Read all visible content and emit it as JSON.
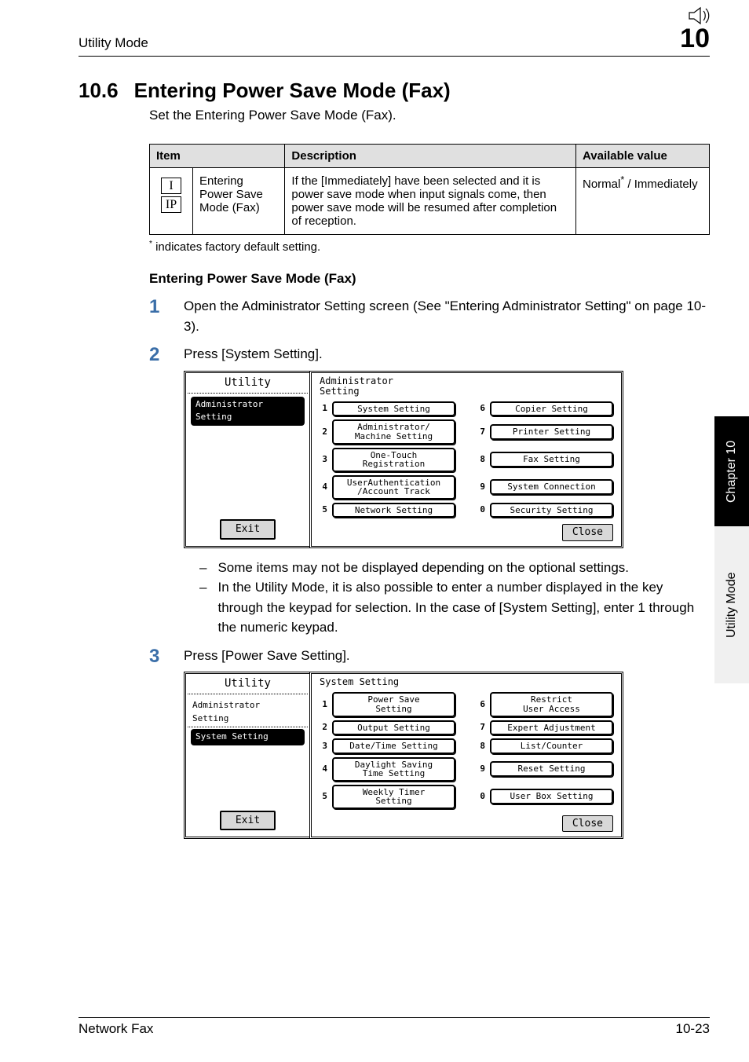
{
  "header": {
    "running_head_left": "Utility Mode",
    "running_head_right": "10"
  },
  "section": {
    "number": "10.6",
    "title": "Entering Power Save Mode (Fax)",
    "lead": "Set the Entering Power Save Mode (Fax)."
  },
  "table": {
    "headers": {
      "item": "Item",
      "description": "Description",
      "available": "Available value"
    },
    "row": {
      "iip_top": "I",
      "iip_bottom": "IP",
      "item_label": "Entering Power Save Mode (Fax)",
      "description": "If the [Immediately] have been selected and it is power save mode when input signals come, then power save mode will be resumed after completion of reception.",
      "available_pre": "Normal",
      "available_sup": "*",
      "available_post": " / Immediately"
    }
  },
  "footnote": " indicates factory default setting.",
  "footnote_star": "*",
  "subhead": "Entering Power Save Mode (Fax)",
  "steps": [
    {
      "n": "1",
      "text": "Open the Administrator Setting screen (See \"Entering Administrator Setting\" on page 10-3)."
    },
    {
      "n": "2",
      "text": "Press [System Setting]."
    },
    {
      "n": "3",
      "text": "Press [Power Save Setting]."
    }
  ],
  "notes_after_panel1": [
    "Some items may not be displayed depending on the optional settings.",
    "In the Utility Mode, it is also possible to enter a number displayed in the key through the keypad for selection. In the case of [System Setting], enter 1 through the numeric keypad."
  ],
  "panel_common": {
    "utility_label": "Utility",
    "sidebar_item": "Administrator\nSetting",
    "exit": "Exit",
    "close": "Close"
  },
  "panel1": {
    "title": "Administrator\nSetting",
    "buttons_left": [
      {
        "n": "1",
        "label": "System Setting"
      },
      {
        "n": "2",
        "label": "Administrator/\nMachine Setting"
      },
      {
        "n": "3",
        "label": "One-Touch\nRegistration"
      },
      {
        "n": "4",
        "label": "UserAuthentication\n/Account Track"
      },
      {
        "n": "5",
        "label": "Network Setting"
      }
    ],
    "buttons_right": [
      {
        "n": "6",
        "label": "Copier Setting"
      },
      {
        "n": "7",
        "label": "Printer Setting"
      },
      {
        "n": "8",
        "label": "Fax Setting"
      },
      {
        "n": "9",
        "label": "System Connection"
      },
      {
        "n": "0",
        "label": "Security Setting"
      }
    ]
  },
  "panel2": {
    "title": "System Setting",
    "sidebar_extra": "System Setting",
    "buttons_left": [
      {
        "n": "1",
        "label": "Power Save\nSetting"
      },
      {
        "n": "2",
        "label": "Output Setting"
      },
      {
        "n": "3",
        "label": "Date/Time Setting"
      },
      {
        "n": "4",
        "label": "Daylight Saving\nTime Setting"
      },
      {
        "n": "5",
        "label": "Weekly Timer\nSetting"
      }
    ],
    "buttons_right": [
      {
        "n": "6",
        "label": "Restrict\nUser Access"
      },
      {
        "n": "7",
        "label": "Expert Adjustment"
      },
      {
        "n": "8",
        "label": "List/Counter"
      },
      {
        "n": "9",
        "label": "Reset Setting"
      },
      {
        "n": "0",
        "label": "User Box Setting"
      }
    ]
  },
  "thumb_tab": {
    "top": "Chapter 10",
    "bottom": "Utility Mode"
  },
  "footer": {
    "left": "Network Fax",
    "right": "10-23"
  }
}
